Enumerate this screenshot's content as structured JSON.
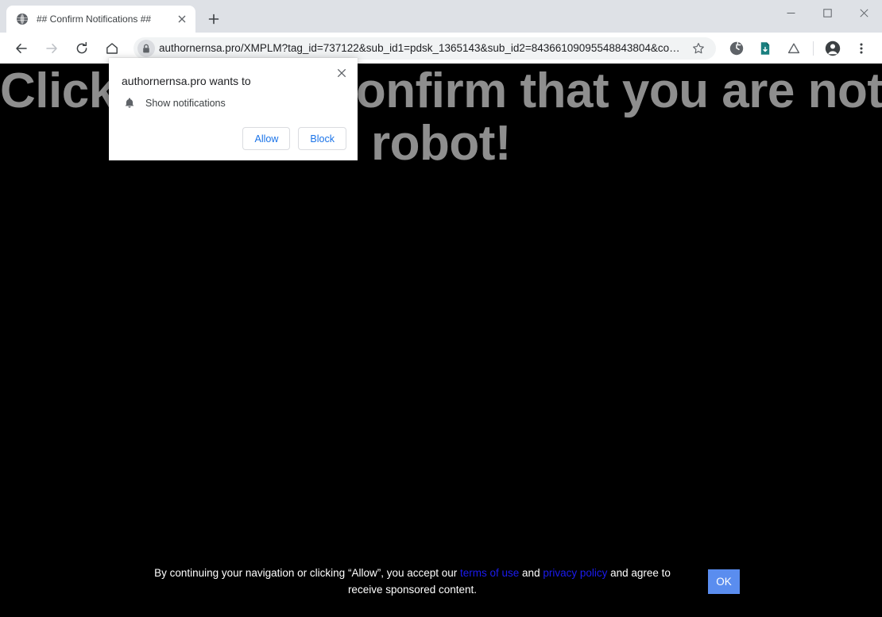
{
  "window": {
    "controls": [
      {
        "name": "minimize",
        "glyph": "minimize-icon"
      },
      {
        "name": "maximize",
        "glyph": "maximize-icon"
      },
      {
        "name": "close",
        "glyph": "close-icon"
      }
    ]
  },
  "browser": {
    "tab": {
      "title": "## Confirm Notifications ##",
      "favicon": "globe-icon",
      "close_label": "Close tab"
    },
    "new_tab_label": "New Tab",
    "nav": {
      "back": "back-arrow-icon",
      "forward": "forward-arrow-icon",
      "reload": "reload-icon",
      "home": "home-icon"
    },
    "omnibox": {
      "url": "authornernsa.pro/XMPLM?tag_id=737122&sub_id1=pdsk_1365143&sub_id2=84366109095548843804&cookie_id...",
      "lock_icon": "lock-icon",
      "bookmark_icon": "star-icon"
    },
    "toolbar_icons": [
      "extension-circle-icon",
      "document-extension-icon",
      "triangle-warning-icon",
      "profile-avatar-icon",
      "three-dot-menu-icon"
    ]
  },
  "page": {
    "headline_line1": "Click Allow to confirm that you are not a",
    "headline_line2": "robot!",
    "headline_color": "#8e8e8e",
    "background_color": "#000000"
  },
  "consent_banner": {
    "text_part1": "By continuing your navigation or clicking “Allow”, you accept our ",
    "link1": "terms of use",
    "text_part2": " and ",
    "link2": "privacy policy",
    "text_part3": " and agree to receive sponsored content.",
    "ok_label": "OK",
    "ok_color": "#5a8def",
    "link_color": "#1b1bef"
  },
  "permission_dialog": {
    "title": "authornernsa.pro wants to",
    "permission_label": "Show notifications",
    "permission_icon": "bell-icon",
    "allow_label": "Allow",
    "block_label": "Block",
    "close_label": "Close",
    "accent_color": "#1a73e8"
  }
}
